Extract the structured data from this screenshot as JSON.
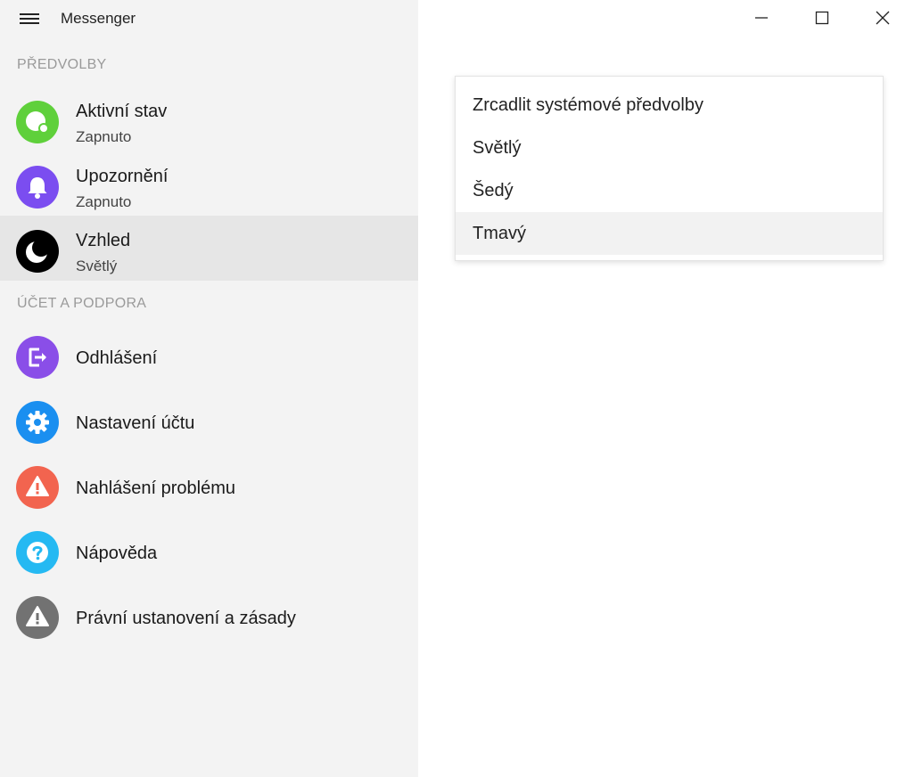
{
  "app": {
    "title": "Messenger"
  },
  "window_controls": {
    "minimize_icon": "minimize-icon",
    "maximize_icon": "maximize-icon",
    "close_icon": "close-icon"
  },
  "sidebar": {
    "sections": [
      {
        "header": "PŘEDVOLBY",
        "items": [
          {
            "label": "Aktivní stav",
            "sub": "Zapnuto",
            "icon": "active-status-icon",
            "color": "#5fd03b"
          },
          {
            "label": "Upozornění",
            "sub": "Zapnuto",
            "icon": "bell-icon",
            "color": "#7b4df0"
          },
          {
            "label": "Vzhled",
            "sub": "Světlý",
            "icon": "moon-icon",
            "color": "#000000",
            "selected": true
          }
        ]
      },
      {
        "header": "ÚČET A PODPORA",
        "items": [
          {
            "label": "Odhlášení",
            "icon": "logout-icon",
            "color": "#8a4ee8"
          },
          {
            "label": "Nastavení účtu",
            "icon": "gear-icon",
            "color": "#1a8ff0"
          },
          {
            "label": "Nahlášení problému",
            "icon": "warning-icon",
            "color": "#f2644f"
          },
          {
            "label": "Nápověda",
            "icon": "help-icon",
            "color": "#25b9f2"
          },
          {
            "label": "Právní ustanovení a zásady",
            "icon": "legal-warning-icon",
            "color": "#727272"
          }
        ]
      }
    ]
  },
  "appearance_dropdown": {
    "options": [
      "Zrcadlit systémové předvolby",
      "Světlý",
      "Šedý",
      "Tmavý"
    ],
    "hovered": "Tmavý"
  }
}
